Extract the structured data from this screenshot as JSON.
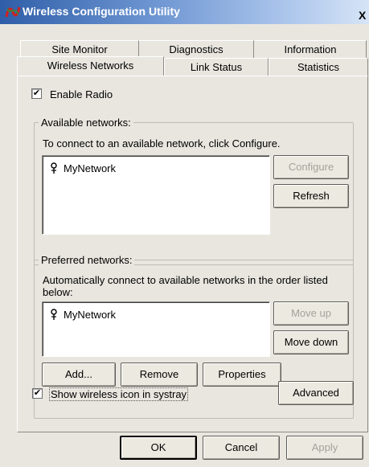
{
  "window": {
    "title": "Wireless Configuration Utility",
    "close_glyph": "X"
  },
  "tabs": {
    "row1": [
      "Site Monitor",
      "Diagnostics",
      "Information"
    ],
    "row2": [
      "Wireless Networks",
      "Link Status",
      "Statistics"
    ],
    "active": "Wireless Networks"
  },
  "enable_radio": {
    "label": "Enable Radio",
    "checked": true
  },
  "available": {
    "title": "Available networks:",
    "instruction": "To connect to an available network, click Configure.",
    "networks": [
      "MyNetwork"
    ],
    "configure_label": "Configure",
    "refresh_label": "Refresh"
  },
  "preferred": {
    "title": "Preferred networks:",
    "instruction_line1": "Automatically connect to available networks in the order listed",
    "instruction_line2": "below:",
    "networks": [
      "MyNetwork"
    ],
    "move_up_label": "Move up",
    "move_down_label": "Move down",
    "add_label": "Add...",
    "remove_label": "Remove",
    "properties_label": "Properties"
  },
  "systray": {
    "label": "Show wireless icon in systray",
    "checked": true
  },
  "advanced_label": "Advanced",
  "footer": {
    "ok_label": "OK",
    "cancel_label": "Cancel",
    "apply_label": "Apply"
  }
}
